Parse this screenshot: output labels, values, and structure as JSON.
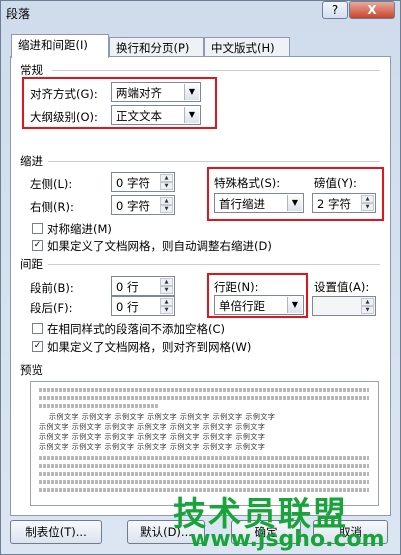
{
  "window": {
    "title": "段落",
    "help_label": "?",
    "close_label": "X"
  },
  "tabs": [
    {
      "label": "缩进和间距(I)"
    },
    {
      "label": "换行和分页(P)"
    },
    {
      "label": "中文版式(H)"
    }
  ],
  "general": {
    "section_label": "常规",
    "alignment_label": "对齐方式(G):",
    "alignment_value": "两端对齐",
    "outline_label": "大纲级别(O):",
    "outline_value": "正文文本"
  },
  "indent": {
    "section_label": "缩进",
    "left_label": "左侧(L):",
    "left_value": "0 字符",
    "right_label": "右侧(R):",
    "right_value": "0 字符",
    "special_label": "特殊格式(S):",
    "special_value": "首行缩进",
    "by_label": "磅值(Y):",
    "by_value": "2 字符",
    "mirror_label": "对称缩进(M)",
    "mirror_checked": false,
    "auto_right_label": "如果定义了文档网格，则自动调整右缩进(D)",
    "auto_right_checked": true
  },
  "spacing": {
    "section_label": "间距",
    "before_label": "段前(B):",
    "before_value": "0 行",
    "after_label": "段后(F):",
    "after_value": "0 行",
    "line_spacing_label": "行距(N):",
    "line_spacing_value": "单倍行距",
    "at_label": "设置值(A):",
    "at_value": "",
    "no_space_label": "在相同样式的段落间不添加空格(C)",
    "no_space_checked": false,
    "snap_grid_label": "如果定义了文档网格，则对齐到网格(W)",
    "snap_grid_checked": true
  },
  "preview": {
    "section_label": "预览",
    "sample_text": "示例文字 示例文字 示例文字 示例文字 示例文字 示例文字 示例文字"
  },
  "buttons": {
    "tabs_label": "制表位(T)...",
    "default_label": "默认(D)...",
    "ok_label": "确定",
    "cancel_label": "取消"
  },
  "watermark": {
    "brand": "技术员联盟",
    "url": "www.jsgho.com"
  },
  "colors": {
    "highlight": "#e2141c",
    "watermark": "#17a43a"
  }
}
